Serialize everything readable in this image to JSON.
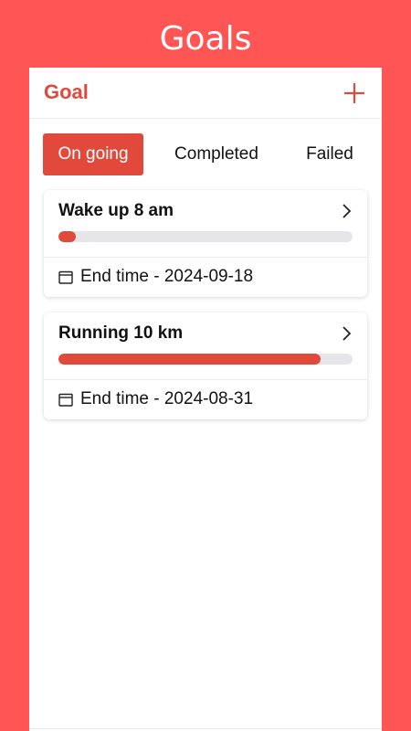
{
  "screen": {
    "title": "Goals"
  },
  "header": {
    "title": "Goal",
    "add_icon": "plus-icon"
  },
  "tabs": [
    {
      "label": "On going",
      "active": true
    },
    {
      "label": "Completed",
      "active": false
    },
    {
      "label": "Failed",
      "active": false
    }
  ],
  "goals": [
    {
      "name": "Wake up 8 am",
      "progress": 0.06,
      "end_time": "End time - 2024-09-18"
    },
    {
      "name": "Running 10 km",
      "progress": 0.89,
      "end_time": "End time - 2024-08-31"
    }
  ],
  "colors": {
    "background": "#FF5555",
    "accent": "#E14A3B",
    "track": "#E6E6EA"
  }
}
